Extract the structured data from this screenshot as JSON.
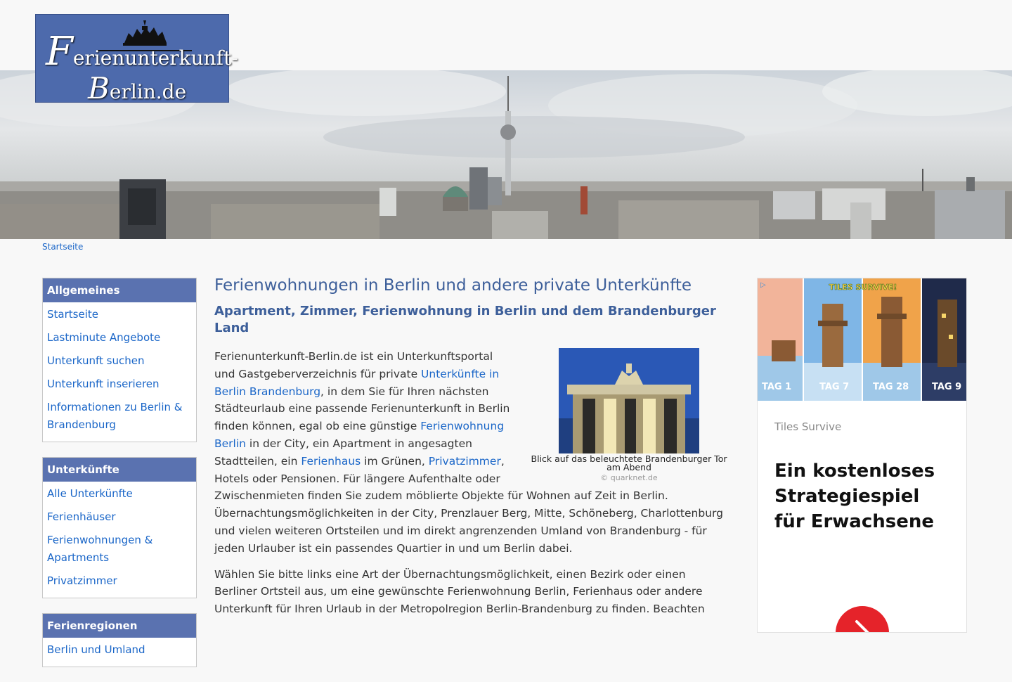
{
  "logo": {
    "line1_initial": "F",
    "line1_rest": "erienunterkunft-",
    "line2_initial": "B",
    "line2_rest": "erlin.de"
  },
  "breadcrumb": {
    "home": "Startseite"
  },
  "sidebar": {
    "sections": [
      {
        "title": "Allgemeines",
        "items": [
          "Startseite",
          "Lastminute Angebote",
          "Unterkunft suchen",
          "Unterkunft inserieren",
          "Informationen zu Berlin & Brandenburg"
        ]
      },
      {
        "title": "Unterkünfte",
        "items": [
          "Alle Unterkünfte",
          "Ferienhäuser",
          "Ferienwohnungen & Apartments",
          "Privatzimmer"
        ]
      },
      {
        "title": "Ferienregionen",
        "items": [
          "Berlin und Umland"
        ]
      }
    ]
  },
  "main": {
    "h1": "Ferienwohnungen in Berlin und andere private Unterkünfte",
    "h2": "Apartment, Zimmer, Ferienwohnung in Berlin und dem Brandenburger Land",
    "figure": {
      "caption": "Blick auf das beleuchtete Brandenburger Tor am Abend",
      "credit": "© quarknet.de"
    },
    "p1": {
      "t1": "Ferienunterkunft-Berlin.de ist ein Unterkunftsportal und Gastgeberverzeichnis für private ",
      "link1": "Unterkünfte in Berlin Brandenburg",
      "t2": ", in dem Sie für Ihren nächsten Städteurlaub eine passende Ferienunterkunft in Berlin finden können, egal ob eine günstige ",
      "link2": "Ferienwohnung Berlin",
      "t3": " in der City, ein Apartment in angesagten Stadtteilen, ein ",
      "link3": "Ferienhaus",
      "t4": " im Grünen, ",
      "link4": "Privatzimmer",
      "t5": ", Hotels oder Pensionen. Für längere Aufenthalte oder Zwischenmieten finden Sie zudem möblierte Objekte für Wohnen auf Zeit in Berlin. Übernachtungsmöglichkeiten in der City, Prenzlauer Berg, Mitte, Schöneberg, Charlottenburg und vielen weiteren Ortsteilen und im direkt angrenzenden Umland von Brandenburg - für jeden Urlauber ist ein passendes Quartier in und um Berlin dabei."
    },
    "p2": "Wählen Sie bitte links eine Art der Übernachtungsmöglichkeit, einen Bezirk oder einen Berliner Ortsteil aus, um eine gewünschte Ferienwohnung Berlin, Ferienhaus oder andere Unterkunft für Ihren Urlaub in der Metropolregion Berlin-Brandenburg zu finden. Beachten"
  },
  "ad": {
    "tiles": [
      "TAG 1",
      "TAG 7",
      "TAG 28",
      "TAG 9"
    ],
    "game_logo": "TILES SURVIVE!",
    "brand": "Tiles Survive",
    "headline": "Ein kostenloses Strategiespiel für Erwachsene"
  },
  "colors": {
    "link": "#1a66c8",
    "heading": "#3d5f9a",
    "sidebar_header": "#5a72b0",
    "logo_bg": "#4d6aac",
    "ad_button": "#e5232a"
  }
}
